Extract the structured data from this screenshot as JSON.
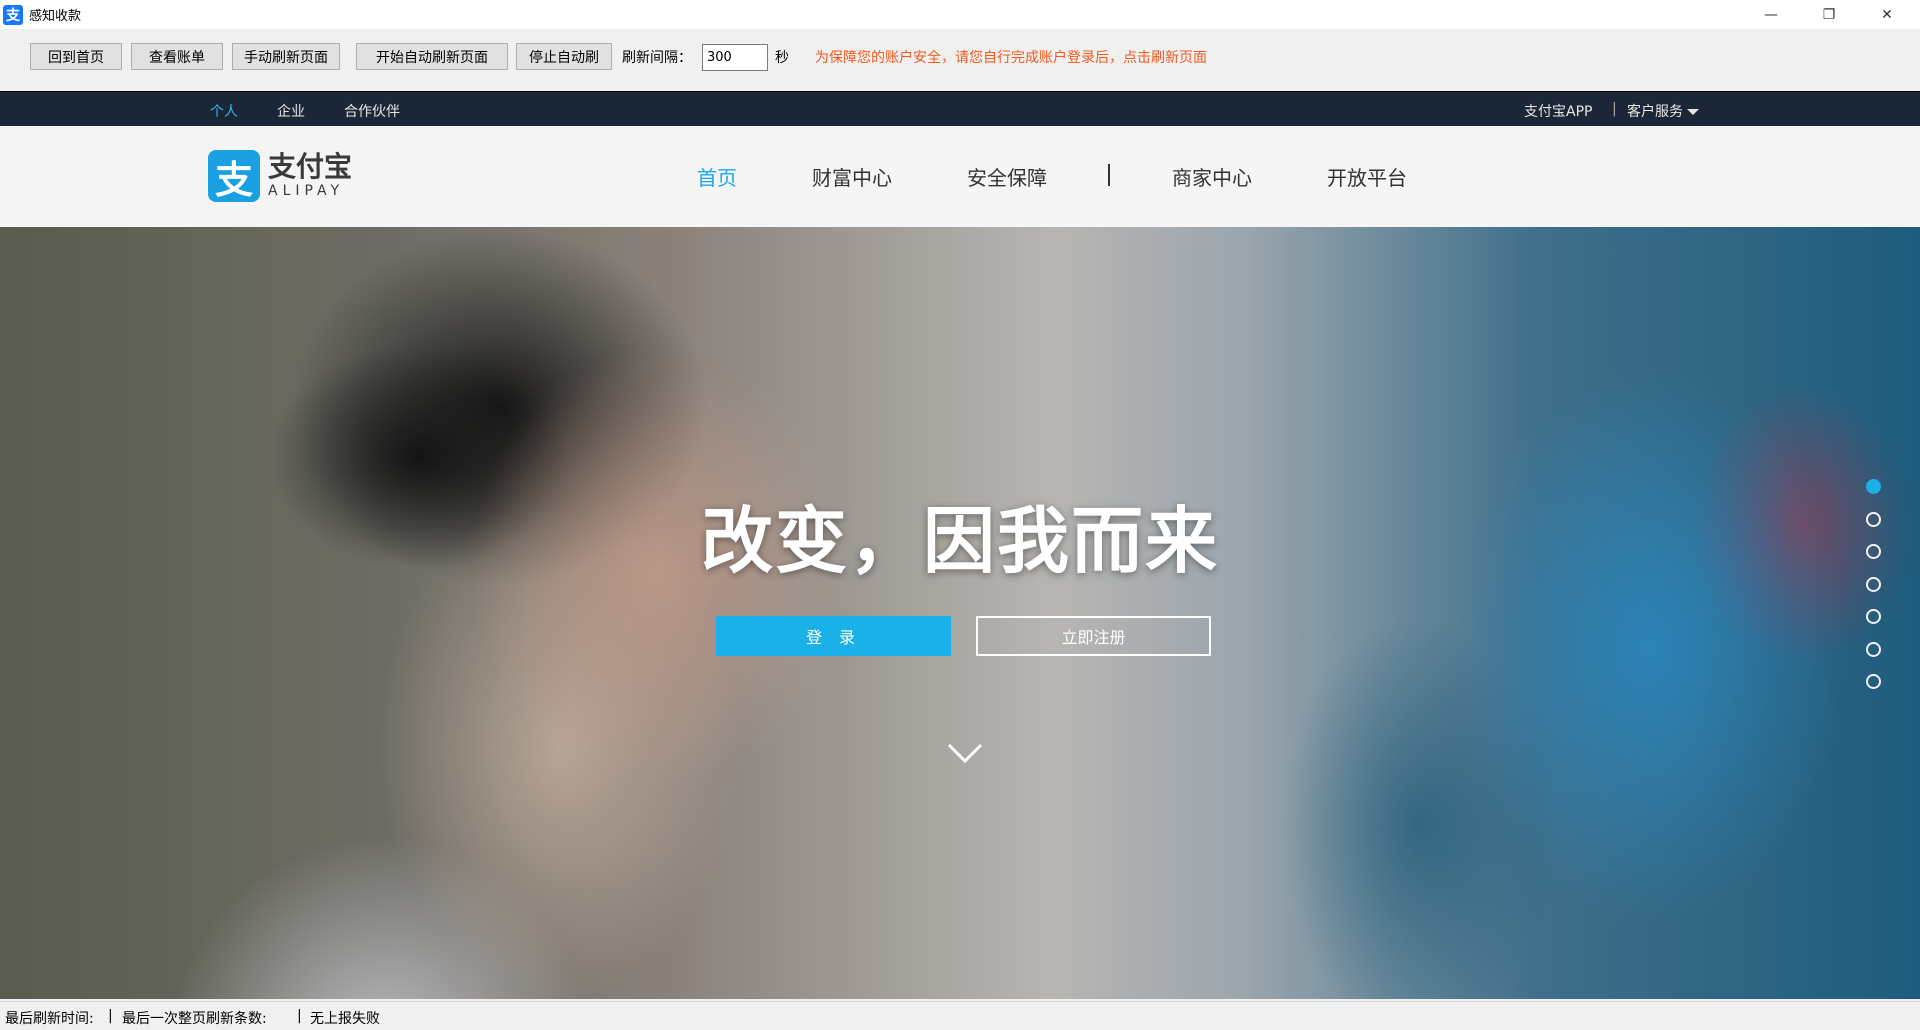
{
  "window": {
    "title": "感知收款",
    "app_icon": "支",
    "controls": {
      "minimize": "—",
      "maximize": "❐",
      "close": "✕"
    }
  },
  "toolbar": {
    "buttons": [
      "回到首页",
      "查看账单",
      "手动刷新页面",
      "开始自动刷新页面",
      "停止自动刷"
    ],
    "interval_label": "刷新间隔：",
    "interval_value": "300",
    "interval_unit": "秒",
    "warning": "为保障您的账户安全，请您自行完成账户登录后，点击刷新页面"
  },
  "site": {
    "topnav": {
      "left": [
        "个人",
        "企业",
        "合作伙伴"
      ],
      "right_app": "支付宝APP",
      "separator": "|",
      "right_service": "客户服务"
    },
    "logo": {
      "mark": "支",
      "cn": "支付宝",
      "en": "ALIPAY"
    },
    "mainnav": [
      "首页",
      "财富中心",
      "安全保障",
      "商家中心",
      "开放平台"
    ],
    "hero": {
      "title": "改变，因我而来",
      "login_button": "登 录",
      "register_button": "立即注册",
      "slide_count": 7,
      "active_slide": 1
    }
  },
  "statusbar": {
    "last_refresh_time": "最后刷新时间:",
    "sep1": "|",
    "last_refresh_count": "最后一次整页刷新条数:",
    "sep2": "|",
    "report_status": "无上报失败"
  },
  "colors": {
    "accent": "#1ab0e8",
    "topnav_bg": "#1b2636",
    "warning": "#f25a1f"
  }
}
